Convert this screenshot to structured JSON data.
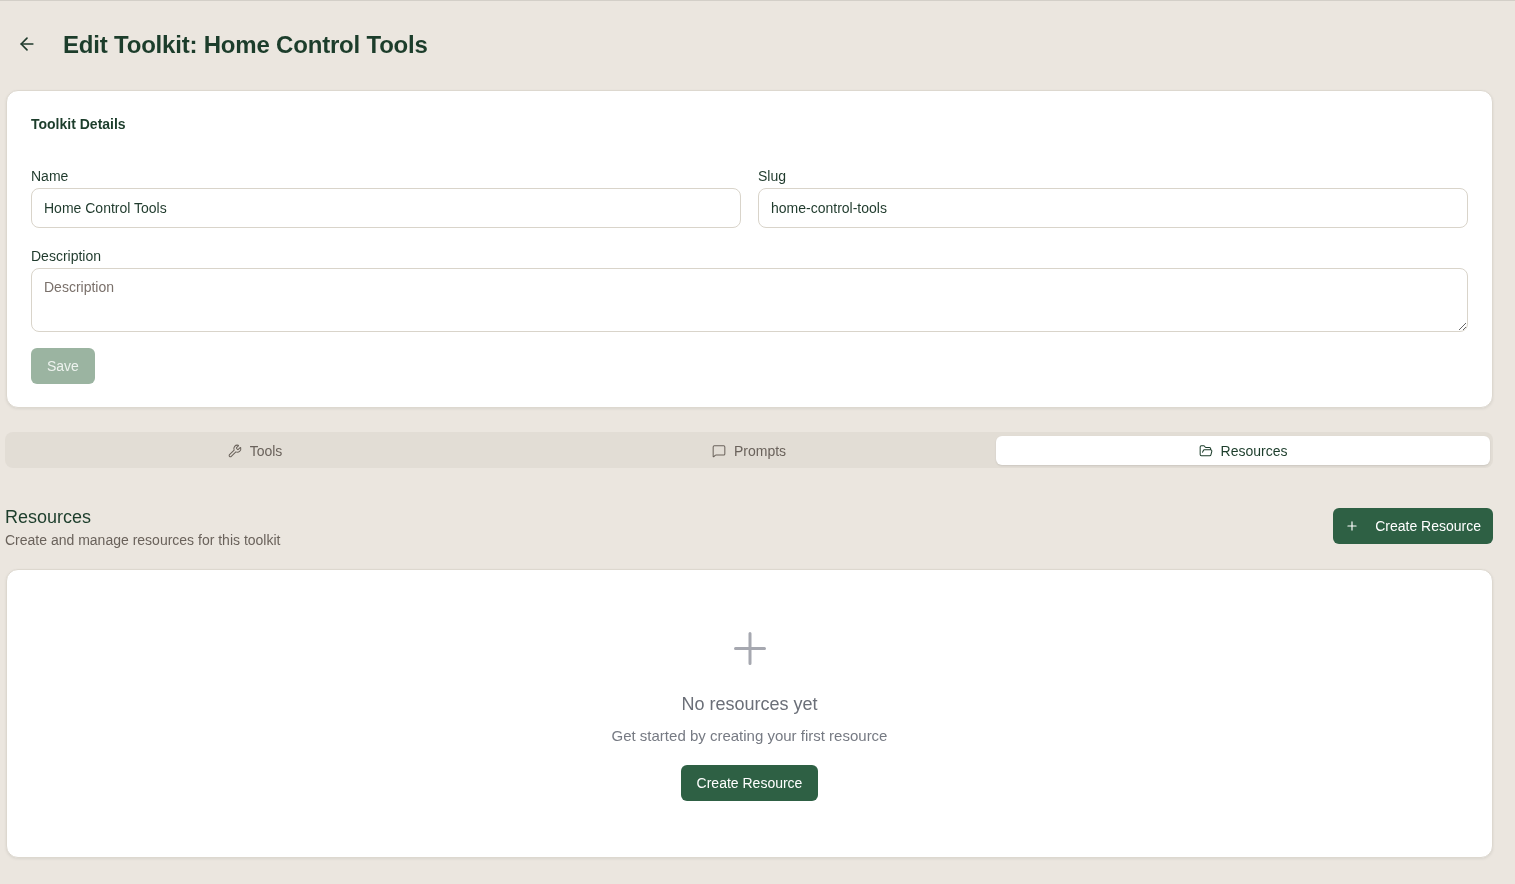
{
  "header": {
    "title": "Edit Toolkit: Home Control Tools"
  },
  "details": {
    "title": "Toolkit Details",
    "fields": [
      {
        "kind": "input",
        "label": "Name",
        "value": "Home Control Tools"
      },
      {
        "kind": "input",
        "label": "Slug",
        "value": "home-control-tools"
      },
      {
        "kind": "textarea",
        "label": "Description",
        "placeholder": "Description"
      }
    ],
    "save_button": {
      "label": "Save",
      "disabled": true
    }
  },
  "tabs": [
    {
      "label": "Tools",
      "selected": false
    },
    {
      "label": "Prompts",
      "selected": false
    },
    {
      "label": "Resources",
      "selected": true
    }
  ],
  "section": {
    "title": "Resources",
    "subtitle": "Create and manage resources for this toolkit",
    "create_button": "Create Resource"
  },
  "empty_state": {
    "title": "No resources yet",
    "message": "Get started by creating your first resource",
    "button": "Create Resource"
  }
}
